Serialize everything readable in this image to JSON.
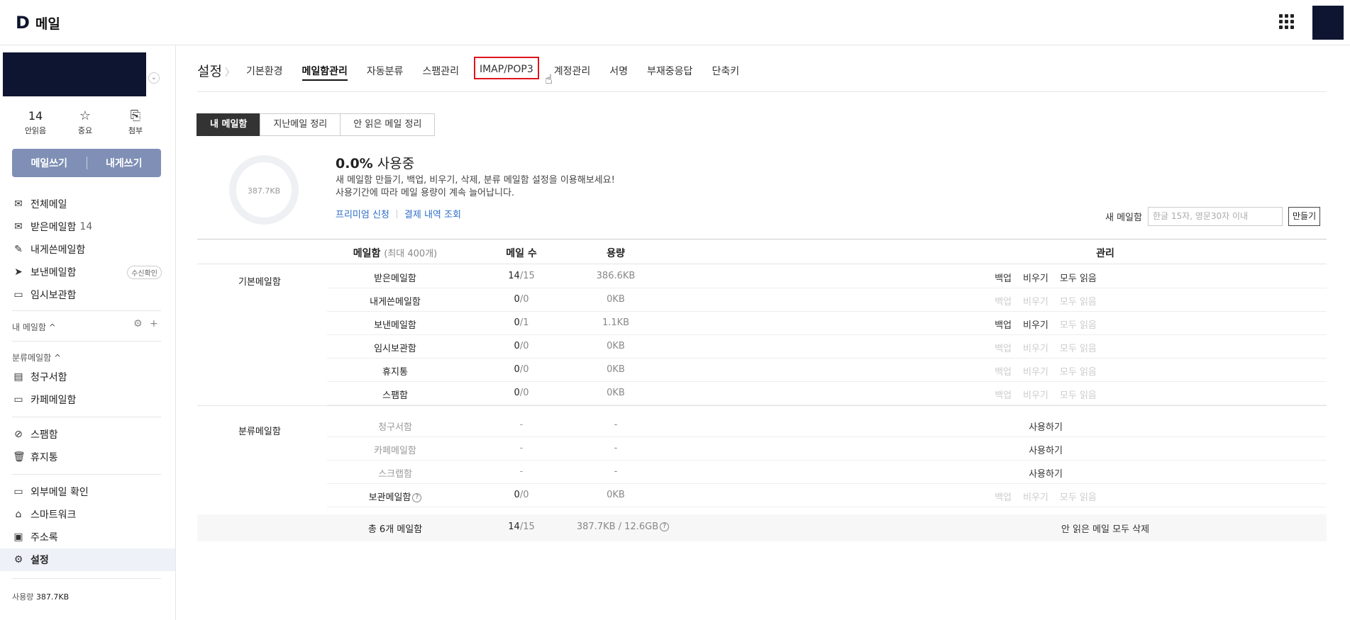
{
  "app": {
    "logo_letter": "D",
    "title": "메일"
  },
  "sidebar": {
    "quick": [
      {
        "value": "14",
        "label": "안읽음"
      },
      {
        "icon": "☆",
        "label": "중요"
      },
      {
        "icon": "⎘",
        "label": "첨부"
      }
    ],
    "write_label": "메일쓰기",
    "self_write_label": "내게쓰기",
    "items": [
      {
        "icon": "✉",
        "label": "전체메일"
      },
      {
        "icon": "✉",
        "label": "받은메일함",
        "count": "14"
      },
      {
        "icon": "✎",
        "label": "내게쓴메일함"
      },
      {
        "icon": "➤",
        "label": "보낸메일함",
        "badge": "수신확인"
      },
      {
        "icon": "▭",
        "label": "임시보관함"
      }
    ],
    "my_mailbox": "내 메일함 ^",
    "category_title": "분류메일함 ^",
    "category_items": [
      {
        "icon": "▤",
        "label": "청구서함"
      },
      {
        "icon": "▭",
        "label": "카페메일함"
      }
    ],
    "misc_items": [
      {
        "icon": "⊘",
        "label": "스팸함"
      },
      {
        "icon": "🗑",
        "label": "휴지통"
      }
    ],
    "tool_items": [
      {
        "icon": "▭",
        "label": "외부메일 확인"
      },
      {
        "icon": "⌂",
        "label": "스마트워크"
      },
      {
        "icon": "▣",
        "label": "주소록"
      },
      {
        "icon": "⚙",
        "label": "설정"
      }
    ],
    "usage_label": "사용량",
    "usage_value": "387.7KB"
  },
  "settings": {
    "title": "설정",
    "tabs": [
      "기본환경",
      "메일함관리",
      "자동분류",
      "스팸관리",
      "IMAP/POP3",
      "계정관리",
      "서명",
      "부재중응답",
      "단축키"
    ],
    "segments": [
      "내 메일함",
      "지난메일 정리",
      "안 읽은 메일 정리"
    ],
    "donut_label": "387.7KB",
    "usage_percent": "0.0%",
    "usage_suffix": "사용중",
    "desc_line1": "새 메일함 만들기, 백업, 비우기, 삭제, 분류 메일함 설정을 이용해보세요!",
    "desc_line2": "사용기간에 따라 메일 용량이 계속 늘어납니다.",
    "link_premium": "프리미엄 신청",
    "link_payment": "결제 내역 조회",
    "new_mailbox_label": "새 메일함",
    "new_mailbox_placeholder": "한글 15자, 영문30자 이내",
    "create_label": "만들기"
  },
  "table": {
    "headers": {
      "name": "메일함",
      "name_sub": "(최대 400개)",
      "count": "메일 수",
      "size": "용량",
      "manage": "관리"
    },
    "group_basic": "기본메일함",
    "group_category": "분류메일함",
    "actions": {
      "backup": "백업",
      "empty": "비우기",
      "read_all": "모두 읽음",
      "use": "사용하기"
    },
    "rows": [
      {
        "name": "받은메일함",
        "read": "14",
        "total": "/15",
        "size": "386.6KB"
      },
      {
        "name": "내게쓴메일함",
        "read": "0",
        "total": "/0",
        "size": "0KB"
      },
      {
        "name": "보낸메일함",
        "read": "0",
        "total": "/1",
        "size": "1.1KB"
      },
      {
        "name": "임시보관함",
        "read": "0",
        "total": "/0",
        "size": "0KB"
      },
      {
        "name": "휴지통",
        "read": "0",
        "total": "/0",
        "size": "0KB"
      },
      {
        "name": "스팸함",
        "read": "0",
        "total": "/0",
        "size": "0KB"
      }
    ],
    "category_rows": [
      {
        "name": "청구서함",
        "count": "-",
        "size": "-"
      },
      {
        "name": "카페메일함",
        "count": "-",
        "size": "-"
      },
      {
        "name": "스크랩함",
        "count": "-",
        "size": "-"
      }
    ],
    "archive_row": {
      "name": "보관메일함",
      "read": "0",
      "total": "/0",
      "size": "0KB"
    },
    "total_row": {
      "name": "총 6개 메일함",
      "read": "14",
      "total": "/15",
      "size": "387.7KB / 12.6GB",
      "action": "안 읽은 메일 모두 삭제"
    }
  }
}
